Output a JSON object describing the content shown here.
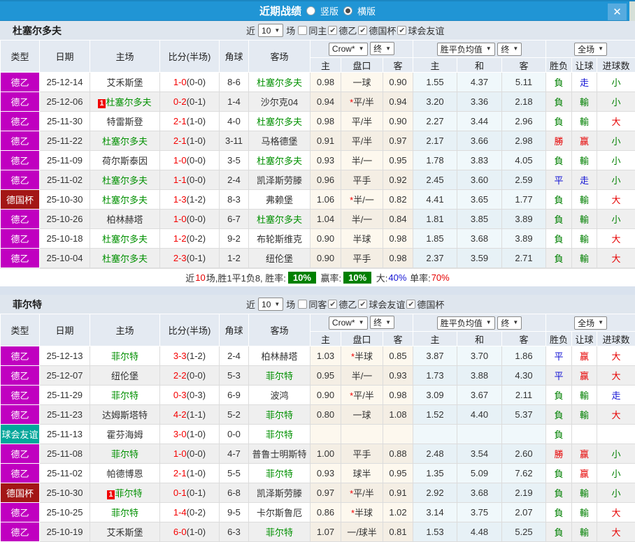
{
  "titlebar": {
    "title": "近期战绩",
    "radio_vertical": "竖版",
    "radio_horizontal": "横版",
    "close_glyph": "✕"
  },
  "columns": {
    "type": "类型",
    "date": "日期",
    "home": "主场",
    "score": "比分(半场)",
    "corner": "角球",
    "away": "客场",
    "odds_home": "主",
    "odds_handicap": "盘口",
    "odds_away": "客",
    "mean_home": "主",
    "mean_draw": "和",
    "mean_away": "客",
    "result": "胜负",
    "spread": "让球",
    "goals": "进球数"
  },
  "dropdowns": {
    "crow": "Crow*",
    "final1": "终",
    "mean": "胜平负均值",
    "final2": "终",
    "fullmatch": "全场"
  },
  "filter_labels": {
    "near": "近",
    "matches": "场"
  },
  "colors": {
    "g": "#008000",
    "r": "#e60000",
    "b": "#1414d4",
    "k": "#333333"
  },
  "leagues": {
    "l2": {
      "label": "德乙",
      "color": "#c000c0"
    },
    "cup": {
      "label": "德国杯",
      "color": "#a31616"
    },
    "fr": {
      "label": "球会友谊",
      "color": "#00a79b"
    }
  },
  "teams": [
    {
      "name": "杜塞尔多夫",
      "filter": {
        "count": "10",
        "same": "同主",
        "same_checked": false,
        "leagues": [
          {
            "label": "德乙",
            "checked": true
          },
          {
            "label": "德国杯",
            "checked": true
          },
          {
            "label": "球会友谊",
            "checked": true
          }
        ]
      },
      "rows": [
        {
          "lg": "l2",
          "date": "25-12-14",
          "home": "艾禾斯堡",
          "hg": false,
          "hb": false,
          "ft": "1-0",
          "ht": "(0-0)",
          "ck": "8-6",
          "away": "杜塞尔多夫",
          "ag": true,
          "o1": "0.98",
          "oh": "一球",
          "os": false,
          "o2": "0.90",
          "m1": "1.55",
          "m2": "4.37",
          "m3": "5.11",
          "r1": "負",
          "c1": "g",
          "r2": "走",
          "c2": "b",
          "r3": "小",
          "c3": "g"
        },
        {
          "lg": "l2",
          "date": "25-12-06",
          "home": "杜塞尔多夫",
          "hg": true,
          "hb": true,
          "ft": "0-2",
          "ht": "(0-1)",
          "ck": "1-4",
          "away": "沙尔克04",
          "ag": false,
          "o1": "0.94",
          "oh": "平/半",
          "os": true,
          "o2": "0.94",
          "m1": "3.20",
          "m2": "3.36",
          "m3": "2.18",
          "r1": "負",
          "c1": "g",
          "r2": "輸",
          "c2": "g",
          "r3": "小",
          "c3": "g"
        },
        {
          "lg": "l2",
          "date": "25-11-30",
          "home": "特雷斯登",
          "hg": false,
          "hb": false,
          "ft": "2-1",
          "ht": "(1-0)",
          "ck": "4-0",
          "away": "杜塞尔多夫",
          "ag": true,
          "o1": "0.98",
          "oh": "平/半",
          "os": false,
          "o2": "0.90",
          "m1": "2.27",
          "m2": "3.44",
          "m3": "2.96",
          "r1": "負",
          "c1": "g",
          "r2": "輸",
          "c2": "g",
          "r3": "大",
          "c3": "r"
        },
        {
          "lg": "l2",
          "date": "25-11-22",
          "home": "杜塞尔多夫",
          "hg": true,
          "hb": false,
          "ft": "2-1",
          "ht": "(1-0)",
          "ck": "3-11",
          "away": "马格德堡",
          "ag": false,
          "o1": "0.91",
          "oh": "平/半",
          "os": false,
          "o2": "0.97",
          "m1": "2.17",
          "m2": "3.66",
          "m3": "2.98",
          "r1": "勝",
          "c1": "r",
          "r2": "赢",
          "c2": "r",
          "r3": "小",
          "c3": "g"
        },
        {
          "lg": "l2",
          "date": "25-11-09",
          "home": "荷尔斯泰因",
          "hg": false,
          "hb": false,
          "ft": "1-0",
          "ht": "(0-0)",
          "ck": "3-5",
          "away": "杜塞尔多夫",
          "ag": true,
          "o1": "0.93",
          "oh": "半/一",
          "os": false,
          "o2": "0.95",
          "m1": "1.78",
          "m2": "3.83",
          "m3": "4.05",
          "r1": "負",
          "c1": "g",
          "r2": "輸",
          "c2": "g",
          "r3": "小",
          "c3": "g"
        },
        {
          "lg": "l2",
          "date": "25-11-02",
          "home": "杜塞尔多夫",
          "hg": true,
          "hb": false,
          "ft": "1-1",
          "ht": "(0-0)",
          "ck": "2-4",
          "away": "凯泽斯劳滕",
          "ag": false,
          "o1": "0.96",
          "oh": "平手",
          "os": false,
          "o2": "0.92",
          "m1": "2.45",
          "m2": "3.60",
          "m3": "2.59",
          "r1": "平",
          "c1": "b",
          "r2": "走",
          "c2": "b",
          "r3": "小",
          "c3": "g"
        },
        {
          "lg": "cup",
          "date": "25-10-30",
          "home": "杜塞尔多夫",
          "hg": true,
          "hb": false,
          "ft": "1-3",
          "ht": "(1-2)",
          "ck": "8-3",
          "away": "弗赖堡",
          "ag": false,
          "o1": "1.06",
          "oh": "半/一",
          "os": true,
          "o2": "0.82",
          "m1": "4.41",
          "m2": "3.65",
          "m3": "1.77",
          "r1": "負",
          "c1": "g",
          "r2": "輸",
          "c2": "g",
          "r3": "大",
          "c3": "r"
        },
        {
          "lg": "l2",
          "date": "25-10-26",
          "home": "柏林赫塔",
          "hg": false,
          "hb": false,
          "ft": "1-0",
          "ht": "(0-0)",
          "ck": "6-7",
          "away": "杜塞尔多夫",
          "ag": true,
          "o1": "1.04",
          "oh": "半/一",
          "os": false,
          "o2": "0.84",
          "m1": "1.81",
          "m2": "3.85",
          "m3": "3.89",
          "r1": "負",
          "c1": "g",
          "r2": "輸",
          "c2": "g",
          "r3": "小",
          "c3": "g"
        },
        {
          "lg": "l2",
          "date": "25-10-18",
          "home": "杜塞尔多夫",
          "hg": true,
          "hb": false,
          "ft": "1-2",
          "ht": "(0-2)",
          "ck": "9-2",
          "away": "布轮斯维克",
          "ag": false,
          "o1": "0.90",
          "oh": "半球",
          "os": false,
          "o2": "0.98",
          "m1": "1.85",
          "m2": "3.68",
          "m3": "3.89",
          "r1": "負",
          "c1": "g",
          "r2": "輸",
          "c2": "g",
          "r3": "大",
          "c3": "r"
        },
        {
          "lg": "l2",
          "date": "25-10-04",
          "home": "杜塞尔多夫",
          "hg": true,
          "hb": false,
          "ft": "2-3",
          "ht": "(0-1)",
          "ck": "1-2",
          "away": "纽伦堡",
          "ag": false,
          "o1": "0.90",
          "oh": "平手",
          "os": false,
          "o2": "0.98",
          "m1": "2.37",
          "m2": "3.59",
          "m3": "2.71",
          "r1": "負",
          "c1": "g",
          "r2": "輸",
          "c2": "g",
          "r3": "大",
          "c3": "r"
        }
      ],
      "summary": [
        {
          "t": "近",
          "c": "k"
        },
        {
          "t": "10",
          "c": "r"
        },
        {
          "t": "场,胜1平1负8, 胜率:",
          "c": "k"
        },
        {
          "t": "10%",
          "c": "box"
        },
        {
          "t": " 赢率:",
          "c": "k"
        },
        {
          "t": "10%",
          "c": "box"
        },
        {
          "t": " 大:",
          "c": "k"
        },
        {
          "t": "40%",
          "c": "b"
        },
        {
          "t": " 单率:",
          "c": "k"
        },
        {
          "t": "70%",
          "c": "r"
        }
      ]
    },
    {
      "name": "菲尔特",
      "filter": {
        "count": "10",
        "same": "同客",
        "same_checked": false,
        "leagues": [
          {
            "label": "德乙",
            "checked": true
          },
          {
            "label": "球会友谊",
            "checked": true
          },
          {
            "label": "德国杯",
            "checked": true
          }
        ]
      },
      "rows": [
        {
          "lg": "l2",
          "date": "25-12-13",
          "home": "菲尔特",
          "hg": true,
          "hb": false,
          "ft": "3-3",
          "ht": "(1-2)",
          "ck": "2-4",
          "away": "柏林赫塔",
          "ag": false,
          "o1": "1.03",
          "oh": "半球",
          "os": true,
          "o2": "0.85",
          "m1": "3.87",
          "m2": "3.70",
          "m3": "1.86",
          "r1": "平",
          "c1": "b",
          "r2": "赢",
          "c2": "r",
          "r3": "大",
          "c3": "r"
        },
        {
          "lg": "l2",
          "date": "25-12-07",
          "home": "纽伦堡",
          "hg": false,
          "hb": false,
          "ft": "2-2",
          "ht": "(0-0)",
          "ck": "5-3",
          "away": "菲尔特",
          "ag": true,
          "o1": "0.95",
          "oh": "半/一",
          "os": false,
          "o2": "0.93",
          "m1": "1.73",
          "m2": "3.88",
          "m3": "4.30",
          "r1": "平",
          "c1": "b",
          "r2": "赢",
          "c2": "r",
          "r3": "大",
          "c3": "r"
        },
        {
          "lg": "l2",
          "date": "25-11-29",
          "home": "菲尔特",
          "hg": true,
          "hb": false,
          "ft": "0-3",
          "ht": "(0-3)",
          "ck": "6-9",
          "away": "波鸿",
          "ag": false,
          "o1": "0.90",
          "oh": "平/半",
          "os": true,
          "o2": "0.98",
          "m1": "3.09",
          "m2": "3.67",
          "m3": "2.11",
          "r1": "負",
          "c1": "g",
          "r2": "輸",
          "c2": "g",
          "r3": "走",
          "c3": "b"
        },
        {
          "lg": "l2",
          "date": "25-11-23",
          "home": "达姆斯塔特",
          "hg": false,
          "hb": false,
          "ft": "4-2",
          "ht": "(1-1)",
          "ck": "5-2",
          "away": "菲尔特",
          "ag": true,
          "o1": "0.80",
          "oh": "一球",
          "os": false,
          "o2": "1.08",
          "m1": "1.52",
          "m2": "4.40",
          "m3": "5.37",
          "r1": "負",
          "c1": "g",
          "r2": "輸",
          "c2": "g",
          "r3": "大",
          "c3": "r"
        },
        {
          "lg": "fr",
          "date": "25-11-13",
          "home": "霍芬海姆",
          "hg": false,
          "hb": false,
          "ft": "3-0",
          "ht": "(1-0)",
          "ck": "0-0",
          "away": "菲尔特",
          "ag": true,
          "o1": "",
          "oh": "",
          "os": false,
          "o2": "",
          "m1": "",
          "m2": "",
          "m3": "",
          "r1": "負",
          "c1": "g",
          "r2": "",
          "c2": "k",
          "r3": "",
          "c3": "k"
        },
        {
          "lg": "l2",
          "date": "25-11-08",
          "home": "菲尔特",
          "hg": true,
          "hb": false,
          "ft": "1-0",
          "ht": "(0-0)",
          "ck": "4-7",
          "away": "普鲁士明斯特",
          "ag": false,
          "o1": "1.00",
          "oh": "平手",
          "os": false,
          "o2": "0.88",
          "m1": "2.48",
          "m2": "3.54",
          "m3": "2.60",
          "r1": "勝",
          "c1": "r",
          "r2": "赢",
          "c2": "r",
          "r3": "小",
          "c3": "g"
        },
        {
          "lg": "l2",
          "date": "25-11-02",
          "home": "帕德博恩",
          "hg": false,
          "hb": false,
          "ft": "2-1",
          "ht": "(1-0)",
          "ck": "5-5",
          "away": "菲尔特",
          "ag": true,
          "o1": "0.93",
          "oh": "球半",
          "os": false,
          "o2": "0.95",
          "m1": "1.35",
          "m2": "5.09",
          "m3": "7.62",
          "r1": "負",
          "c1": "g",
          "r2": "赢",
          "c2": "r",
          "r3": "小",
          "c3": "g"
        },
        {
          "lg": "cup",
          "date": "25-10-30",
          "home": "菲尔特",
          "hg": true,
          "hb": true,
          "ft": "0-1",
          "ht": "(0-1)",
          "ck": "6-8",
          "away": "凯泽斯劳滕",
          "ag": false,
          "o1": "0.97",
          "oh": "平/半",
          "os": true,
          "o2": "0.91",
          "m1": "2.92",
          "m2": "3.68",
          "m3": "2.19",
          "r1": "負",
          "c1": "g",
          "r2": "輸",
          "c2": "g",
          "r3": "小",
          "c3": "g"
        },
        {
          "lg": "l2",
          "date": "25-10-25",
          "home": "菲尔特",
          "hg": true,
          "hb": false,
          "ft": "1-4",
          "ht": "(0-2)",
          "ck": "9-5",
          "away": "卡尔斯鲁厄",
          "ag": false,
          "o1": "0.86",
          "oh": "半球",
          "os": true,
          "o2": "1.02",
          "m1": "3.14",
          "m2": "3.75",
          "m3": "2.07",
          "r1": "負",
          "c1": "g",
          "r2": "輸",
          "c2": "g",
          "r3": "大",
          "c3": "r"
        },
        {
          "lg": "l2",
          "date": "25-10-19",
          "home": "艾禾斯堡",
          "hg": false,
          "hb": false,
          "ft": "6-0",
          "ht": "(1-0)",
          "ck": "6-3",
          "away": "菲尔特",
          "ag": true,
          "o1": "1.07",
          "oh": "一/球半",
          "os": false,
          "o2": "0.81",
          "m1": "1.53",
          "m2": "4.48",
          "m3": "5.25",
          "r1": "負",
          "c1": "g",
          "r2": "輸",
          "c2": "g",
          "r3": "大",
          "c3": "r"
        }
      ],
      "summary": null
    }
  ]
}
